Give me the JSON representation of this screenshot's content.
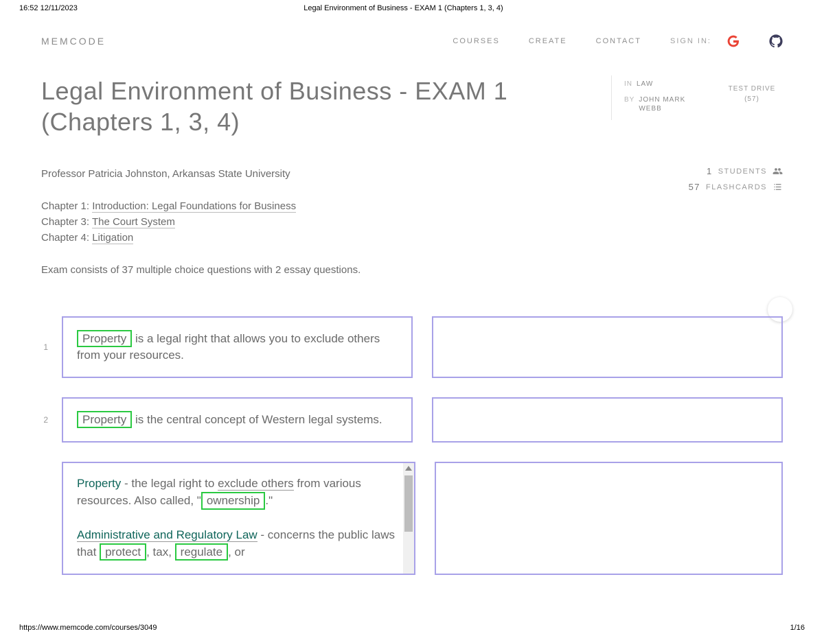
{
  "print": {
    "timestamp": "16:52 12/11/2023",
    "doc_title": "Legal Environment of Business - EXAM 1 (Chapters 1, 3, 4)",
    "url": "https://www.memcode.com/courses/3049",
    "page": "1/16"
  },
  "nav": {
    "logo": "MEMCODE",
    "courses": "COURSES",
    "create": "CREATE",
    "contact": "CONTACT",
    "signin": "SIGN IN:"
  },
  "course": {
    "title": "Legal Environment of Business - EXAM 1 (Chapters 1, 3, 4)",
    "in_label": "IN",
    "in_value": "LAW",
    "by_label": "BY",
    "by_value": "JOHN MARK WEBB",
    "test_drive": "TEST DRIVE",
    "test_drive_count": "(57)"
  },
  "desc": {
    "professor": "Professor Patricia Johnston, Arkansas State University",
    "ch1_prefix": "Chapter 1: ",
    "ch1_link": "Introduction: Legal Foundations for Business",
    "ch3_prefix": "Chapter 3: ",
    "ch3_link": "The Court System",
    "ch4_prefix": "Chapter 4: ",
    "ch4_link": "Litigation",
    "exam_info": "Exam consists of 37 multiple choice questions with 2 essay questions."
  },
  "stats": {
    "students_n": "1",
    "students_label": "STUDENTS",
    "flash_n": "57",
    "flash_label": "FLASHCARDS"
  },
  "cards": [
    {
      "n": "1",
      "q_blank": "Property",
      "q_rest": " is a legal right that allows you to exclude others from your resources."
    },
    {
      "n": "2",
      "q_blank": "Property",
      "q_rest": " is the central concept of Western legal systems."
    }
  ],
  "card3": {
    "h1": "Property",
    "t1a": " - the legal right to ",
    "t1u": "exclude others",
    "t1b": " from various resources. Also called, \"",
    "box1": "ownership",
    "t1c": ".\"",
    "h2": "Administrative and Regulatory Law",
    "t2a": " - concerns the public laws that ",
    "box2a": "protect",
    "t2b": ", tax, ",
    "box2b": "regulate",
    "t2c": ", or"
  }
}
